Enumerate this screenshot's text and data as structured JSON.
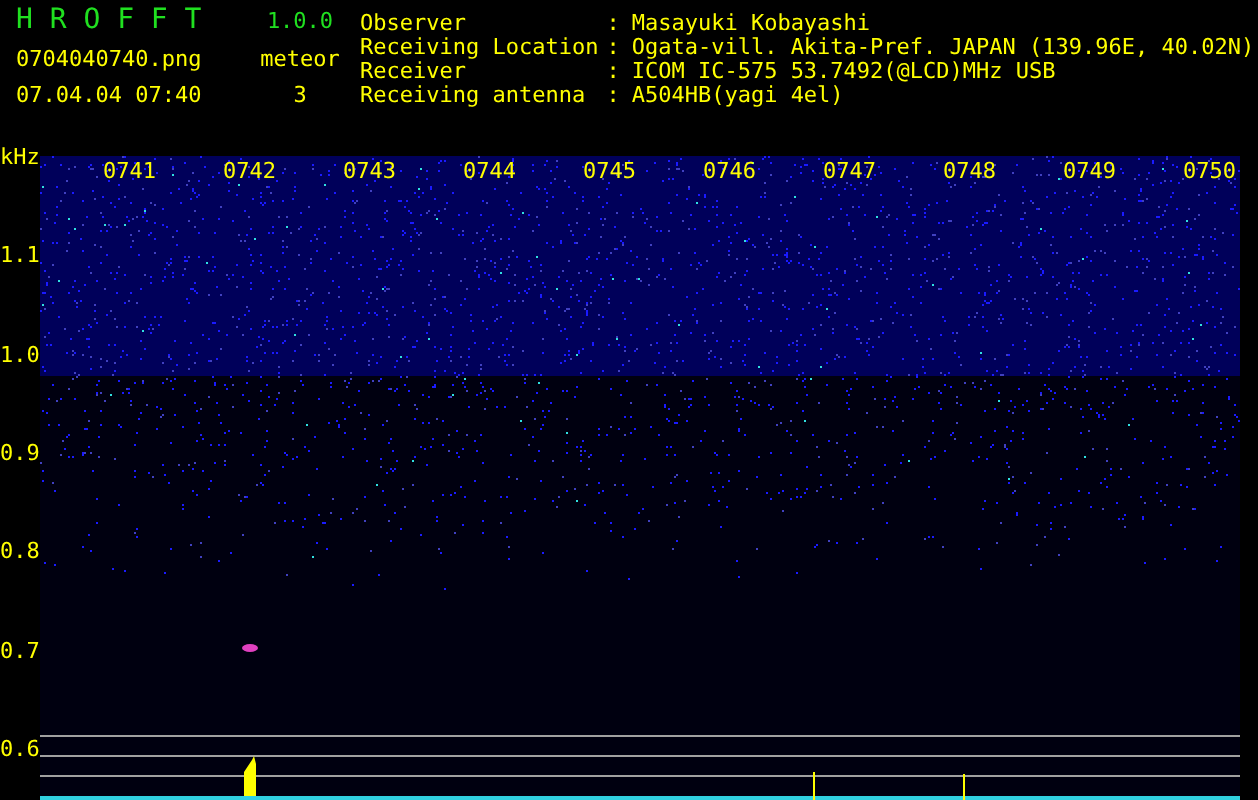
{
  "header": {
    "app_name": "H R O F F T",
    "version": "1.0.0",
    "filename": "0704040740.png",
    "timestamp": "07.04.04 07:40",
    "meteor_label": "meteor",
    "meteor_count": "3"
  },
  "station_info": [
    {
      "label": "Observer",
      "separator": ":",
      "value": "Masayuki Kobayashi"
    },
    {
      "label": "Receiving Location",
      "separator": ":",
      "value": "Ogata-vill. Akita-Pref. JAPAN (139.96E, 40.02N)"
    },
    {
      "label": "Receiver",
      "separator": ":",
      "value": "ICOM IC-575 53.7492(@LCD)MHz USB"
    },
    {
      "label": "Receiving antenna",
      "separator": ":",
      "value": "A504HB(yagi 4el)"
    }
  ],
  "spectrogram": {
    "unit": "kHz",
    "time_labels": [
      "0741",
      "0742",
      "0743",
      "0744",
      "0745",
      "0746",
      "0747",
      "0748",
      "0749",
      "0750"
    ],
    "frequency_labels": [
      "1.1",
      "1.0",
      "0.9",
      "0.8",
      "0.7",
      "0.6"
    ]
  }
}
